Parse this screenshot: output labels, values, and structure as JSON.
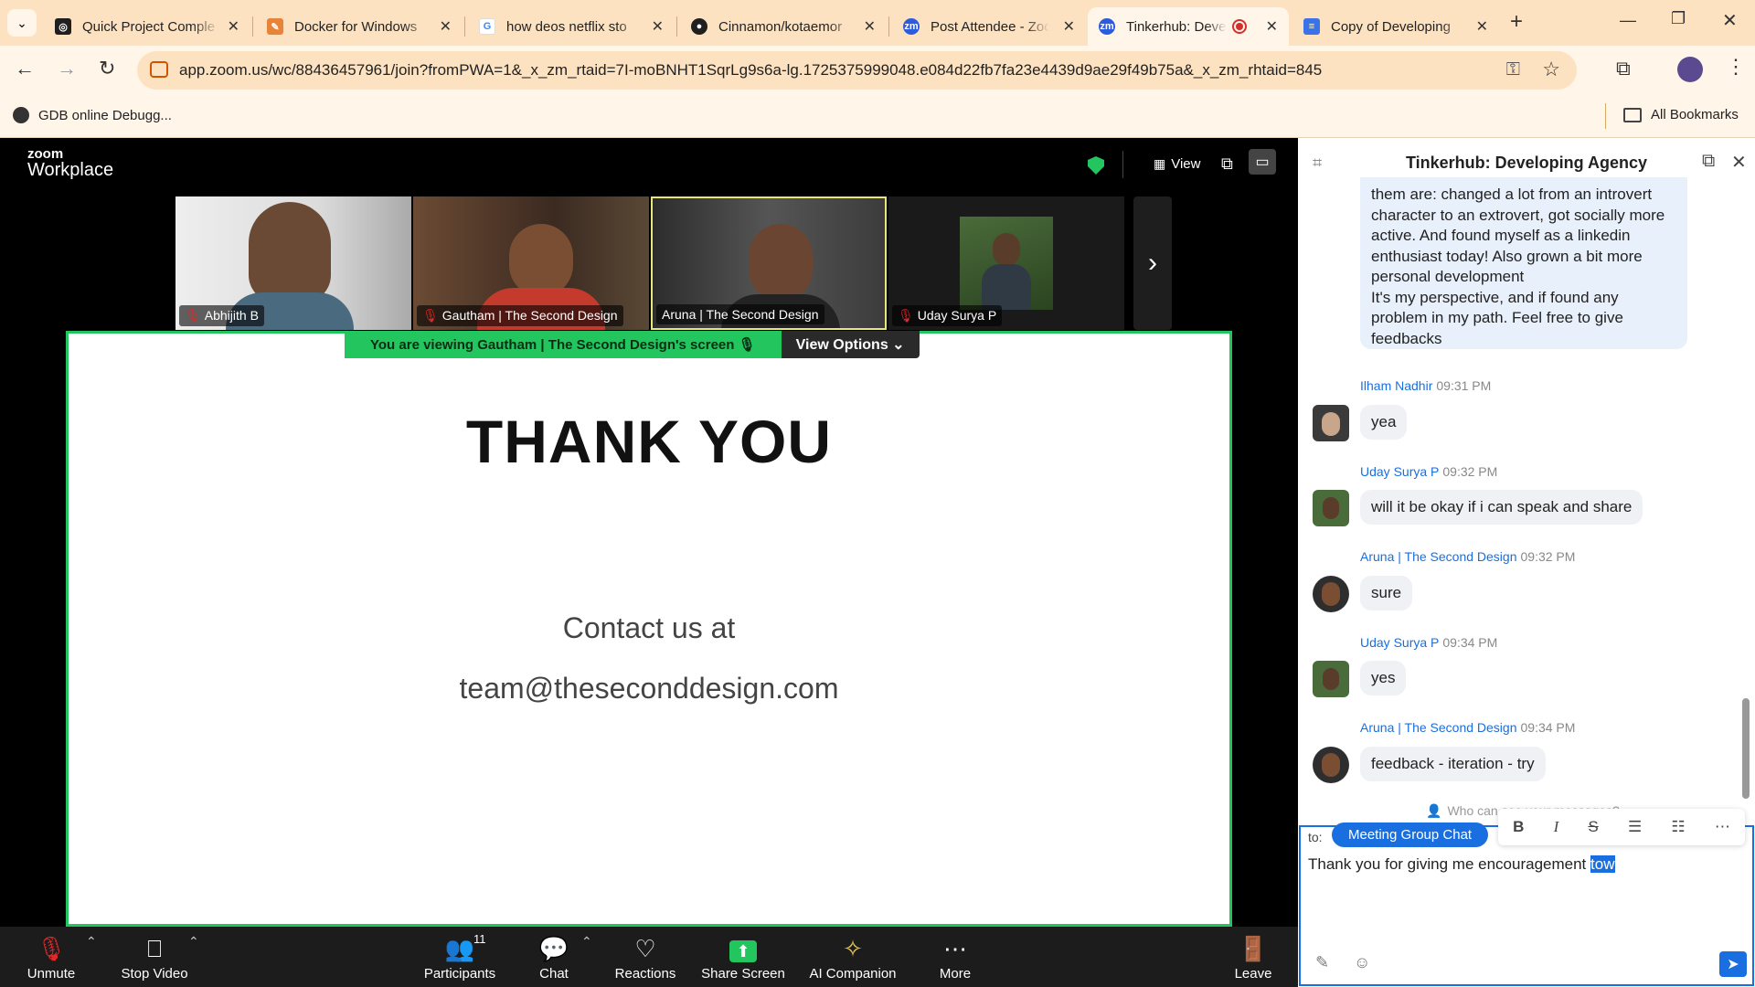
{
  "browser": {
    "tabs": [
      {
        "label": "Quick Project Comple",
        "icon": "openai-icon",
        "color": "#1f1f1f"
      },
      {
        "label": "Docker for Windows",
        "icon": "doc-icon",
        "color": "#e8833a"
      },
      {
        "label": "how deos netflix sto",
        "icon": "google-icon",
        "color": "#4285f4"
      },
      {
        "label": "Cinnamon/kotaemor",
        "icon": "github-icon",
        "color": "#1f1f1f"
      },
      {
        "label": "Post Attendee - Zoo",
        "icon": "zoom-icon",
        "color": "#2d5bde"
      },
      {
        "label": "Tinkerhub: Devel",
        "icon": "zoom-icon",
        "color": "#2d5bde"
      },
      {
        "label": "Copy of Developing",
        "icon": "docs-icon",
        "color": "#3a73e8"
      }
    ],
    "url": "app.zoom.us/wc/88436457961/join?fromPWA=1&_x_zm_rtaid=7I-moBNHT1SqrLg9s6a-lg.1725375999048.e084d22fb7fa23e4439d9ae29f49b75a&_x_zm_rhtaid=845",
    "bookmark": "GDB online Debugg...",
    "all_bookmarks": "All Bookmarks"
  },
  "zoom": {
    "logo_top": "zoom",
    "logo_bottom": "Workplace",
    "view_label": "View",
    "participants": [
      {
        "name": "Abhijith B"
      },
      {
        "name": "Gautham | The Second Design"
      },
      {
        "name": "Aruna | The Second Design"
      },
      {
        "name": "Uday Surya P"
      }
    ],
    "banner": "You are viewing  Gautham | The Second Design's screen",
    "view_options": "View Options",
    "slide": {
      "title": "THANK YOU",
      "contact": "Contact us at",
      "email": "team@theseconddesign.com"
    },
    "toolbar": {
      "unmute": "Unmute",
      "stop_video": "Stop Video",
      "participants": "Participants",
      "participant_count": "11",
      "chat": "Chat",
      "reactions": "Reactions",
      "share_screen": "Share Screen",
      "ai_companion": "AI Companion",
      "more": "More",
      "leave": "Leave"
    }
  },
  "chat": {
    "title": "Tinkerhub: Developing Agency",
    "first_bubble": [
      "them are:  changed a lot from an introvert",
      "character to an extrovert, got socially more",
      "active. And found myself as a linkedin",
      "enthusiast today! Also grown a bit more",
      "personal development",
      "It's my perspective, and if found any",
      "problem in my path. Feel free to give",
      "feedbacks"
    ],
    "messages": [
      {
        "name": "Ilham Nadhir",
        "time": "09:31 PM",
        "text": "yea"
      },
      {
        "name": "Uday Surya P",
        "time": "09:32 PM",
        "text": "will it be okay if i can speak and share"
      },
      {
        "name": "Aruna | The Second Design",
        "time": "09:32 PM",
        "text": "sure"
      },
      {
        "name": "Uday Surya P",
        "time": "09:34 PM",
        "text": "yes"
      },
      {
        "name": "Aruna | The Second Design",
        "time": "09:34 PM",
        "text": "feedback - iteration - try"
      }
    ],
    "who_can_see": "Who can see your messages?",
    "to_label": "to:",
    "recipient": "Meeting Group Chat",
    "draft_text": "Thank you for giving me encouragement",
    "draft_selected": "tow"
  }
}
